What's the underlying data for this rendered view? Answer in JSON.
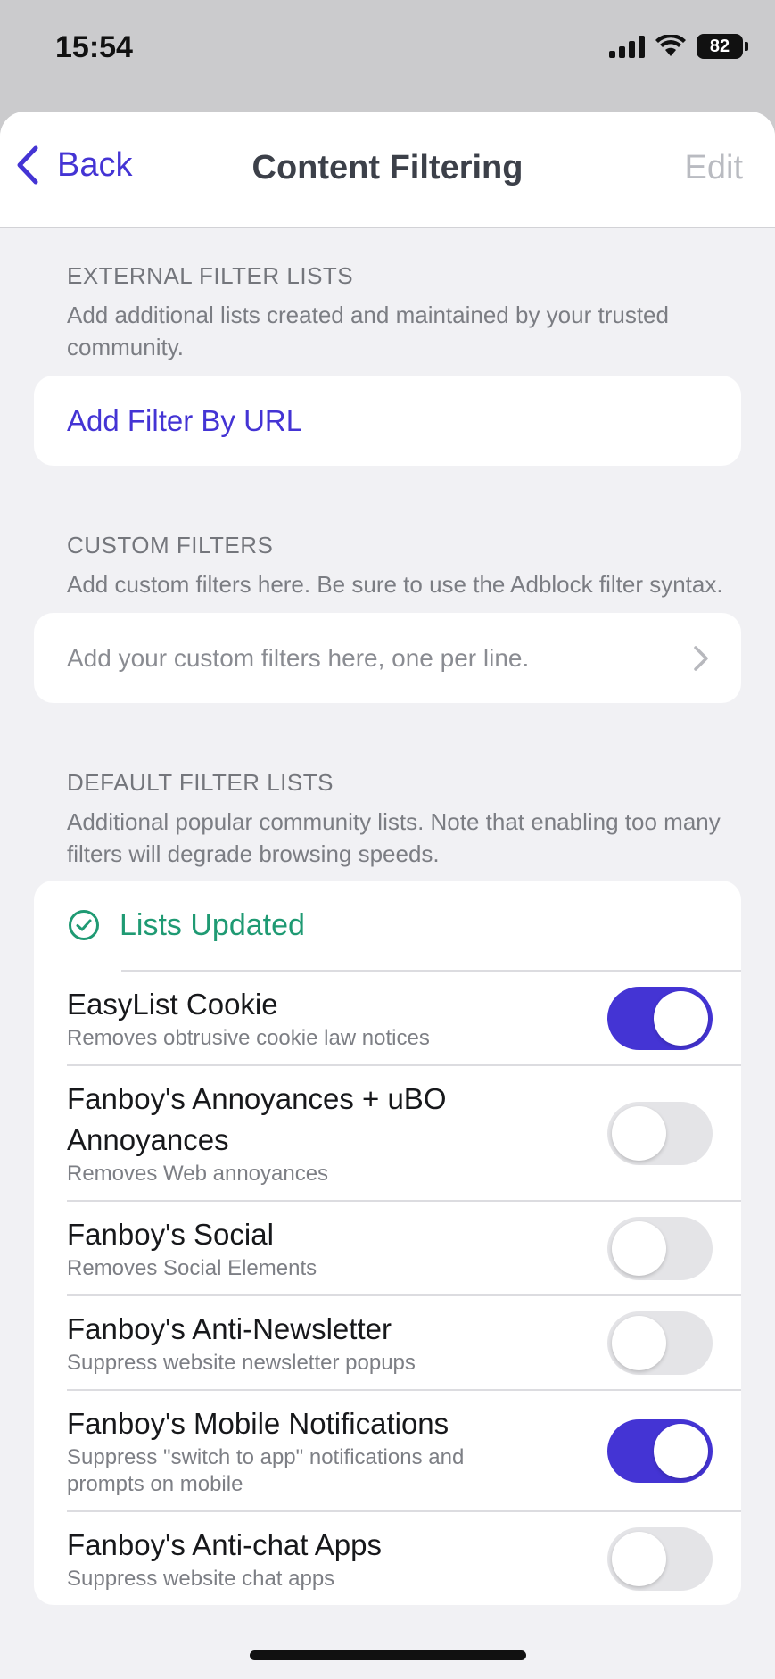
{
  "status": {
    "time": "15:54",
    "battery": "82"
  },
  "nav": {
    "back_label": "Back",
    "title": "Content Filtering",
    "edit_label": "Edit"
  },
  "external": {
    "title": "EXTERNAL FILTER LISTS",
    "description": "Add additional lists created and maintained by your trusted community.",
    "add_label": "Add Filter By URL"
  },
  "custom": {
    "title": "CUSTOM FILTERS",
    "description": "Add custom filters here. Be sure to use the Adblock filter syntax.",
    "placeholder": "Add your custom filters here, one per line."
  },
  "default": {
    "title": "DEFAULT FILTER LISTS",
    "description": "Additional popular community lists. Note that enabling too many filters will degrade browsing speeds.",
    "status": "Lists Updated",
    "items": [
      {
        "name": "EasyList Cookie",
        "description": "Removes obtrusive cookie law notices",
        "enabled": true
      },
      {
        "name": "Fanboy's Annoyances + uBO Annoyances",
        "description": "Removes Web annoyances",
        "enabled": false
      },
      {
        "name": "Fanboy's Social",
        "description": "Removes Social Elements",
        "enabled": false
      },
      {
        "name": "Fanboy's Anti-Newsletter",
        "description": "Suppress website newsletter popups",
        "enabled": false
      },
      {
        "name": "Fanboy's Mobile Notifications",
        "description": "Suppress \"switch to app\" notifications and prompts on mobile",
        "enabled": true
      },
      {
        "name": "Fanboy's Anti-chat Apps",
        "description": "Suppress website chat apps",
        "enabled": false
      }
    ]
  },
  "colors": {
    "accent": "#4434d4",
    "success": "#1f9a73",
    "background": "#f1f1f4"
  }
}
